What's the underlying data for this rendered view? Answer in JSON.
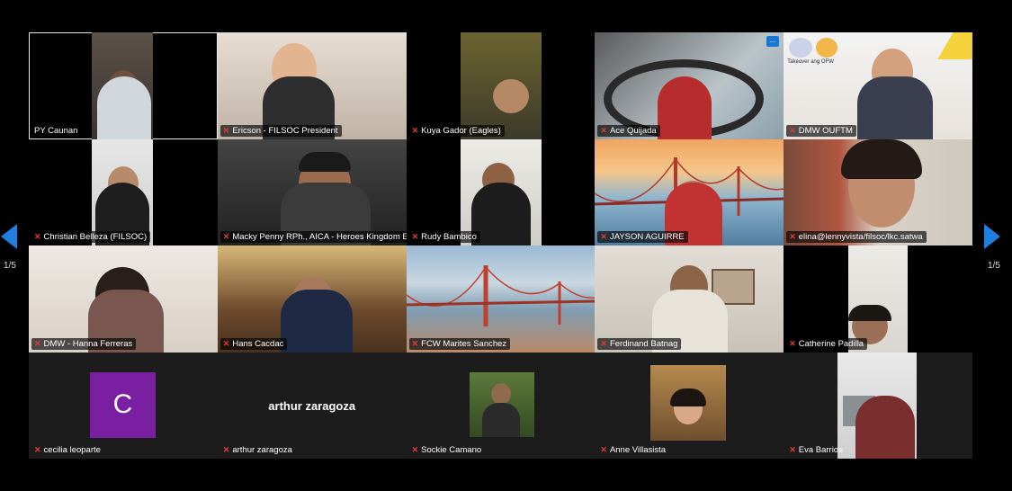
{
  "pagination": {
    "left": "1/5",
    "right": "1/5"
  },
  "more_button": "...",
  "participants": [
    {
      "name": "PY Caunan"
    },
    {
      "name": "Ericson - FILSOC President"
    },
    {
      "name": "Kuya Gador (Eagles)"
    },
    {
      "name": "Ace Quijada"
    },
    {
      "name": "DMW OUFTM"
    },
    {
      "name": "Christian Belleza (FILSOC)"
    },
    {
      "name": "Macky Penny RPh., AICA - Heroes Kingdom E..."
    },
    {
      "name": "Rudy Bambico"
    },
    {
      "name": "JAYSON AGUIRRE"
    },
    {
      "name": "elina@lennyvista/filsoc/lkc.satwa"
    },
    {
      "name": "DMW - Hanna Ferreras"
    },
    {
      "name": "Hans Cacdac"
    },
    {
      "name": "FCW Marites Sanchez"
    },
    {
      "name": "Ferdinand Batnag"
    },
    {
      "name": "Catherine Padilla"
    },
    {
      "name": "cecilia leoparte",
      "avatar_letter": "C",
      "avatar_color": "#7b1fa2"
    },
    {
      "name": "arthur zaragoza",
      "display_name": "arthur zaragoza"
    },
    {
      "name": "Sockie Camano"
    },
    {
      "name": "Anne Villasista"
    },
    {
      "name": "Eva Barrios"
    }
  ],
  "banner_text": "Takeover ang OFW"
}
